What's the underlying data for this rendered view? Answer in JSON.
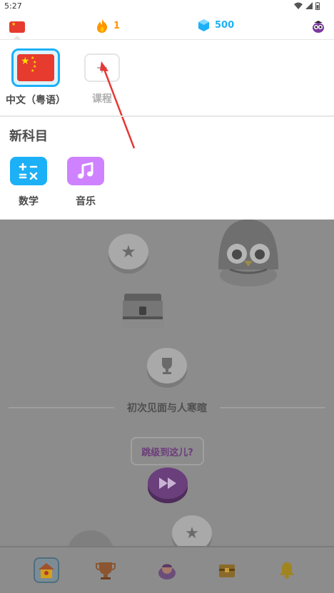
{
  "status_bar": {
    "time": "5:27"
  },
  "top_bar": {
    "streak_count": "1",
    "gems_count": "500"
  },
  "courses": {
    "current_label": "中文（粤语）",
    "add_label": "课程"
  },
  "new_subjects": {
    "title": "新科目",
    "items": [
      {
        "label": "数学",
        "icon": "math-icon",
        "color": "#1cb0f6"
      },
      {
        "label": "音乐",
        "icon": "music-icon",
        "color": "#ce82ff"
      }
    ]
  },
  "path": {
    "section_title": "初次见面与人寒暄",
    "jump_label": "跳级到这儿?"
  },
  "colors": {
    "brand_blue": "#1cb0f6",
    "streak_orange": "#ff9600",
    "flag_red": "#e63b2e"
  }
}
